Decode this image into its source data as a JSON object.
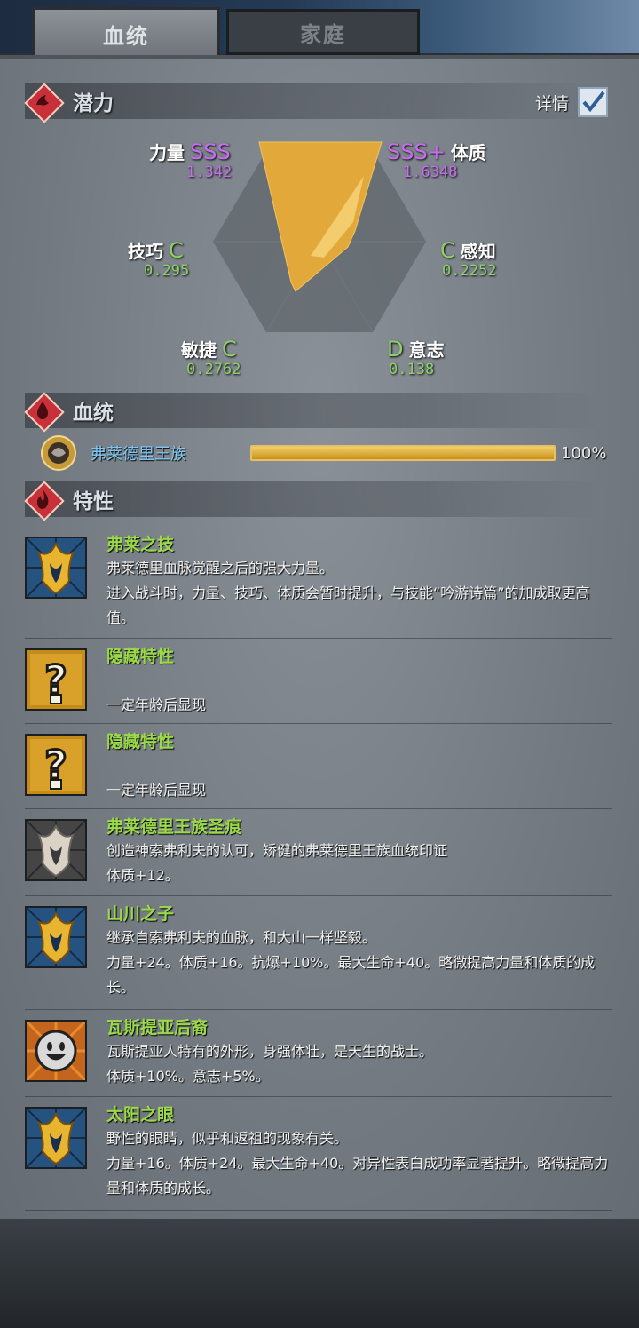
{
  "tabs": [
    {
      "label": "血统",
      "active": true
    },
    {
      "label": "家庭",
      "active": false
    }
  ],
  "sections": {
    "potential": "潜力",
    "bloodline": "血统",
    "traits": "特性"
  },
  "detail_label": "详情",
  "detail_checked": true,
  "stats": {
    "strength": {
      "name": "力量",
      "grade": "SSS",
      "value": "1.342"
    },
    "constitution": {
      "name": "体质",
      "grade": "SSS+",
      "value": "1.6348"
    },
    "skill": {
      "name": "技巧",
      "grade": "C",
      "value": "0.295"
    },
    "perception": {
      "name": "感知",
      "grade": "C",
      "value": "0.2252"
    },
    "agility": {
      "name": "敏捷",
      "grade": "C",
      "value": "0.2762"
    },
    "will": {
      "name": "意志",
      "grade": "D",
      "value": "0.138"
    }
  },
  "bloodline": {
    "name": "弗莱德里王族",
    "progress": 100,
    "progress_label": "100%"
  },
  "traits": [
    {
      "name": "弗莱之技",
      "icon": "golden-horn-crest-icon",
      "desc": "弗莱德里血脉觉醒之后的强大力量。\n进入战斗时，力量、技巧、体质会暂时提升，与技能“吟游诗篇”的加成取更高值。"
    },
    {
      "name": "隐藏特性",
      "icon": "question-mark-icon",
      "desc": "\n一定年龄后显现"
    },
    {
      "name": "隐藏特性",
      "icon": "question-mark-icon",
      "desc": "\n一定年龄后显现"
    },
    {
      "name": "弗莱德里王族圣痕",
      "icon": "silver-horn-crest-icon",
      "desc": "创造神索弗利夫的认可，矫健的弗莱德里王族血统印证\n体质+12。"
    },
    {
      "name": "山川之子",
      "icon": "golden-horn-crest-icon",
      "desc": "继承自索弗利夫的血脉，和大山一样坚毅。\n力量+24。体质+16。抗爆+10%。最大生命+40。略微提高力量和体质的成长。"
    },
    {
      "name": "瓦斯提亚后裔",
      "icon": "smiling-face-icon",
      "desc": "瓦斯提亚人特有的外形，身强体壮，是天生的战士。\n体质+10%。意志+5%。"
    },
    {
      "name": "太阳之眼",
      "icon": "golden-horn-crest-icon",
      "desc": "野性的眼睛，似乎和返祖的现象有关。\n力量+16。体质+24。最大生命+40。对异性表白成功率显著提升。略微提高力量和体质的成长。"
    }
  ]
}
